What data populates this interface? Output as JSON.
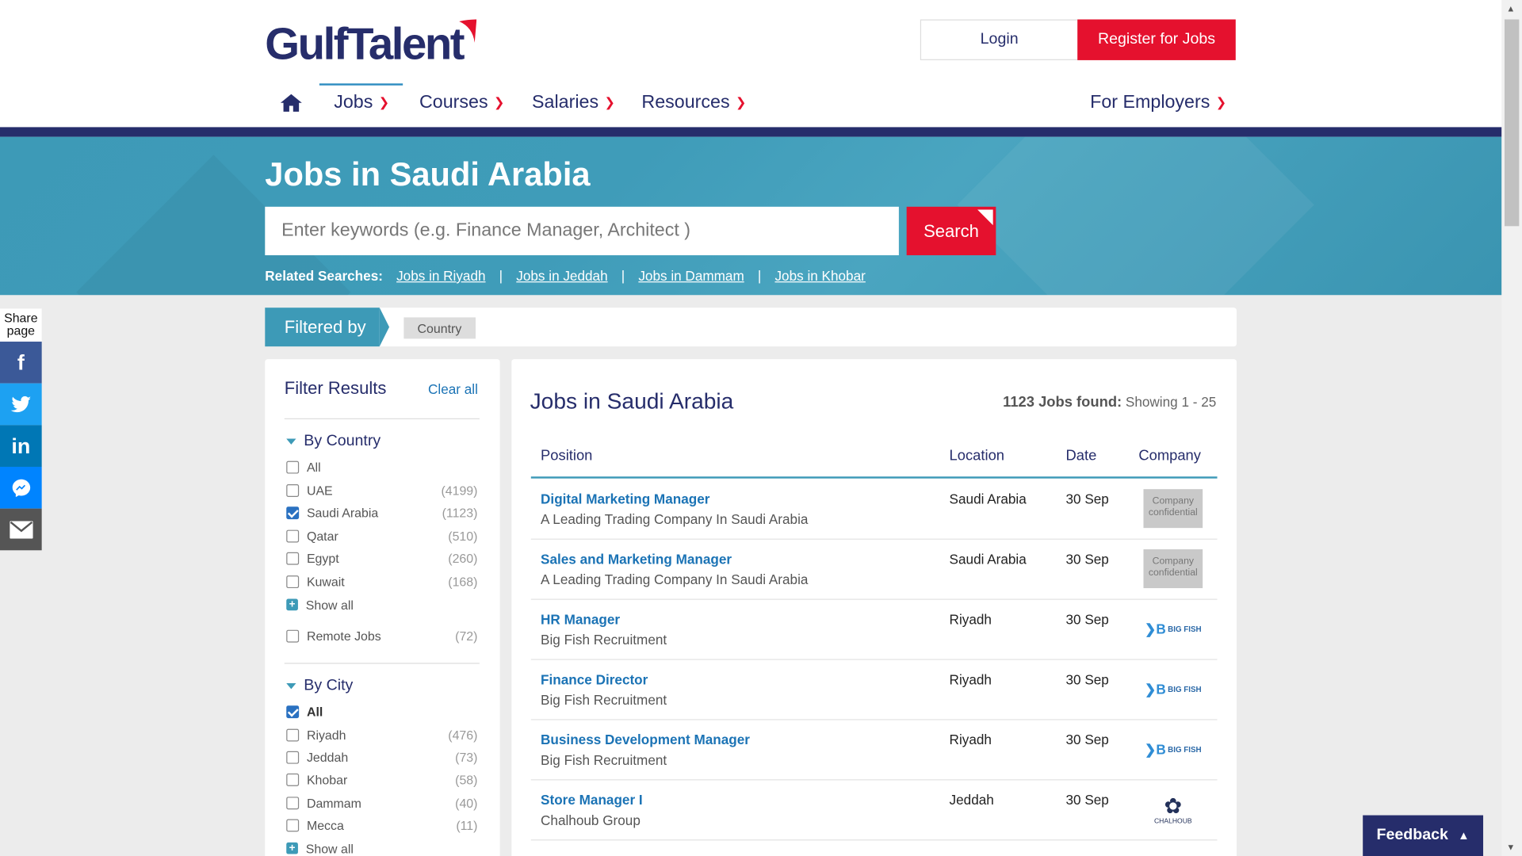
{
  "header": {
    "logo_text": "GulfTalent",
    "login_label": "Login",
    "register_label": "Register for Jobs",
    "nav": [
      {
        "label": "Jobs"
      },
      {
        "label": "Courses"
      },
      {
        "label": "Salaries"
      },
      {
        "label": "Resources"
      }
    ],
    "employers_label": "For Employers"
  },
  "hero": {
    "title": "Jobs in Saudi Arabia",
    "search_placeholder": "Enter keywords (e.g. Finance Manager, Architect )",
    "search_button": "Search",
    "related_label": "Related Searches:",
    "related": [
      "Jobs in Riyadh",
      "Jobs in Jeddah",
      "Jobs in Dammam",
      "Jobs in Khobar"
    ]
  },
  "share": {
    "label": "Share page"
  },
  "filtered": {
    "label": "Filtered by",
    "chip": "Country"
  },
  "sidebar": {
    "title": "Filter Results",
    "clear_all": "Clear all",
    "country_title": "By Country",
    "countries": [
      {
        "label": "All",
        "count": "",
        "checked": false
      },
      {
        "label": "UAE",
        "count": "(4199)",
        "checked": false
      },
      {
        "label": "Saudi Arabia",
        "count": "(1123)",
        "checked": true
      },
      {
        "label": "Qatar",
        "count": "(510)",
        "checked": false
      },
      {
        "label": "Egypt",
        "count": "(260)",
        "checked": false
      },
      {
        "label": "Kuwait",
        "count": "(168)",
        "checked": false
      }
    ],
    "show_all": "Show all",
    "remote": {
      "label": "Remote Jobs",
      "count": "(72)"
    },
    "city_title": "By City",
    "cities": [
      {
        "label": "All",
        "count": "",
        "checked": true
      },
      {
        "label": "Riyadh",
        "count": "(476)",
        "checked": false
      },
      {
        "label": "Jeddah",
        "count": "(73)",
        "checked": false
      },
      {
        "label": "Khobar",
        "count": "(58)",
        "checked": false
      },
      {
        "label": "Dammam",
        "count": "(40)",
        "checked": false
      },
      {
        "label": "Mecca",
        "count": "(11)",
        "checked": false
      }
    ],
    "city_show_all": "Show all"
  },
  "main": {
    "title": "Jobs in Saudi Arabia",
    "found_count": "1123 Jobs found:",
    "showing": "Showing 1 - 25",
    "columns": {
      "position": "Position",
      "location": "Location",
      "date": "Date",
      "company": "Company"
    },
    "jobs": [
      {
        "title": "Digital Marketing Manager",
        "company": "A Leading Trading Company In Saudi Arabia",
        "location": "Saudi Arabia",
        "date": "30 Sep",
        "logo": "confidential"
      },
      {
        "title": "Sales and Marketing Manager",
        "company": "A Leading Trading Company In Saudi Arabia",
        "location": "Saudi Arabia",
        "date": "30 Sep",
        "logo": "confidential"
      },
      {
        "title": "HR Manager",
        "company": "Big Fish Recruitment",
        "location": "Riyadh",
        "date": "30 Sep",
        "logo": "bigfish"
      },
      {
        "title": "Finance Director",
        "company": "Big Fish Recruitment",
        "location": "Riyadh",
        "date": "30 Sep",
        "logo": "bigfish"
      },
      {
        "title": "Business Development Manager",
        "company": "Big Fish Recruitment",
        "location": "Riyadh",
        "date": "30 Sep",
        "logo": "bigfish"
      },
      {
        "title": "Store Manager I",
        "company": "Chalhoub Group",
        "location": "Jeddah",
        "date": "30 Sep",
        "logo": "chalhoub"
      }
    ],
    "confidential_logo_text": "Company confidential",
    "bigfish_logo_text": "BIG FISH",
    "chalhoub_logo_text": "CHALHOUB"
  },
  "feedback": {
    "label": "Feedback"
  },
  "colors": {
    "brand_navy": "#262d6b",
    "brand_red": "#e5112e",
    "hero_teal": "#3d9ab7",
    "link_blue": "#1b73b5"
  }
}
